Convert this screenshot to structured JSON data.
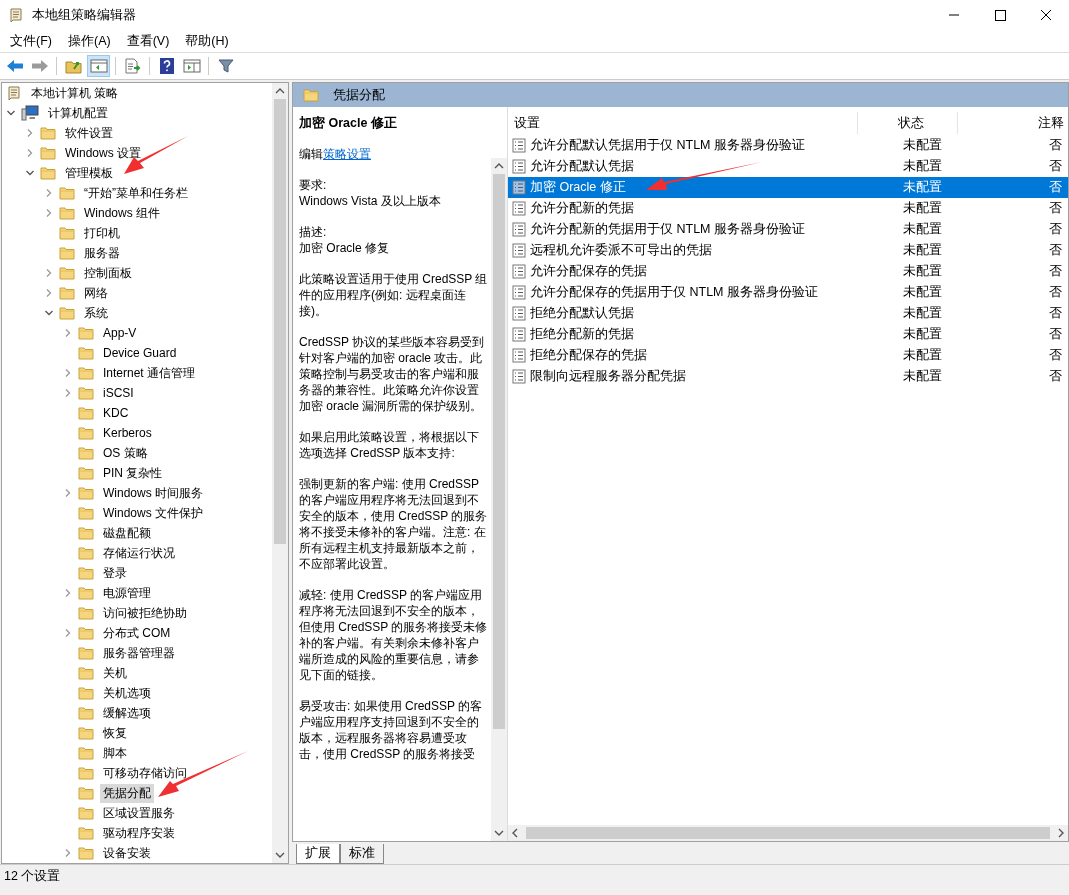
{
  "window": {
    "title": "本地组策略编辑器"
  },
  "menu": [
    "文件(F)",
    "操作(A)",
    "查看(V)",
    "帮助(H)"
  ],
  "toolbar": [
    {
      "kind": "back",
      "disabled": false
    },
    {
      "kind": "forward",
      "disabled": true
    },
    {
      "kind": "separator"
    },
    {
      "kind": "up"
    },
    {
      "kind": "tree",
      "pressed": true
    },
    {
      "kind": "separator"
    },
    {
      "kind": "export"
    },
    {
      "kind": "separator"
    },
    {
      "kind": "help"
    },
    {
      "kind": "pane",
      "pressed": false
    },
    {
      "kind": "separator"
    },
    {
      "kind": "filter"
    }
  ],
  "tree": [
    {
      "label": "本地计算机 策略",
      "kind": "root",
      "selected": false,
      "children": [
        {
          "label": "计算机配置",
          "kind": "computer",
          "expanded": true,
          "selected": false,
          "children": [
            {
              "label": "软件设置",
              "kind": "folder",
              "expanded": false,
              "selected": false
            },
            {
              "label": "Windows 设置",
              "kind": "folder",
              "expanded": false,
              "selected": false
            },
            {
              "label": "管理模板",
              "kind": "folder",
              "expanded": true,
              "selected": false,
              "children": [
                {
                  "label": "“开始”菜单和任务栏",
                  "kind": "folder",
                  "expanded": false,
                  "selected": false
                },
                {
                  "label": "Windows 组件",
                  "kind": "folder",
                  "expanded": false,
                  "selected": false
                },
                {
                  "label": "打印机",
                  "kind": "folder",
                  "selected": false
                },
                {
                  "label": "服务器",
                  "kind": "folder",
                  "selected": false
                },
                {
                  "label": "控制面板",
                  "kind": "folder",
                  "expanded": false,
                  "selected": false
                },
                {
                  "label": "网络",
                  "kind": "folder",
                  "expanded": false,
                  "selected": false
                },
                {
                  "label": "系统",
                  "kind": "folder",
                  "expanded": true,
                  "selected": false,
                  "children": [
                    {
                      "label": "App-V",
                      "kind": "folder",
                      "expanded": false,
                      "selected": false
                    },
                    {
                      "label": "Device Guard",
                      "kind": "folder",
                      "selected": false
                    },
                    {
                      "label": "Internet 通信管理",
                      "kind": "folder",
                      "expanded": false,
                      "selected": false
                    },
                    {
                      "label": "iSCSI",
                      "kind": "folder",
                      "expanded": false,
                      "selected": false
                    },
                    {
                      "label": "KDC",
                      "kind": "folder",
                      "selected": false
                    },
                    {
                      "label": "Kerberos",
                      "kind": "folder",
                      "selected": false
                    },
                    {
                      "label": "OS 策略",
                      "kind": "folder",
                      "selected": false
                    },
                    {
                      "label": "PIN 复杂性",
                      "kind": "folder",
                      "selected": false
                    },
                    {
                      "label": "Windows 时间服务",
                      "kind": "folder",
                      "expanded": false,
                      "selected": false
                    },
                    {
                      "label": "Windows 文件保护",
                      "kind": "folder",
                      "selected": false
                    },
                    {
                      "label": "磁盘配额",
                      "kind": "folder",
                      "selected": false
                    },
                    {
                      "label": "存储运行状况",
                      "kind": "folder",
                      "selected": false
                    },
                    {
                      "label": "登录",
                      "kind": "folder",
                      "selected": false
                    },
                    {
                      "label": "电源管理",
                      "kind": "folder",
                      "expanded": false,
                      "selected": false
                    },
                    {
                      "label": "访问被拒绝协助",
                      "kind": "folder",
                      "selected": false
                    },
                    {
                      "label": "分布式 COM",
                      "kind": "folder",
                      "expanded": false,
                      "selected": false
                    },
                    {
                      "label": "服务器管理器",
                      "kind": "folder",
                      "selected": false
                    },
                    {
                      "label": "关机",
                      "kind": "folder",
                      "selected": false
                    },
                    {
                      "label": "关机选项",
                      "kind": "folder",
                      "selected": false
                    },
                    {
                      "label": "缓解选项",
                      "kind": "folder",
                      "selected": false
                    },
                    {
                      "label": "恢复",
                      "kind": "folder",
                      "selected": false
                    },
                    {
                      "label": "脚本",
                      "kind": "folder",
                      "selected": false
                    },
                    {
                      "label": "可移动存储访问",
                      "kind": "folder",
                      "selected": false
                    },
                    {
                      "label": "凭据分配",
                      "kind": "folder",
                      "selected": true
                    },
                    {
                      "label": "区域设置服务",
                      "kind": "folder",
                      "selected": false
                    },
                    {
                      "label": "驱动程序安装",
                      "kind": "folder",
                      "selected": false
                    },
                    {
                      "label": "设备安装",
                      "kind": "folder",
                      "expanded": false,
                      "selected": false
                    }
                  ]
                }
              ]
            }
          ]
        }
      ]
    }
  ],
  "header": {
    "title": "凭据分配"
  },
  "description": {
    "title": "加密 Oracle 修正",
    "edit_prefix": "编辑",
    "edit_link": "策略设置",
    "paragraphs": [
      "要求:\nWindows Vista 及以上版本",
      "描述:\n加密 Oracle 修复",
      "此策略设置适用于使用 CredSSP 组件的应用程序(例如: 远程桌面连接)。",
      "CredSSP 协议的某些版本容易受到针对客户端的加密 oracle 攻击。此策略控制与易受攻击的客户端和服务器的兼容性。此策略允许你设置加密 oracle 漏洞所需的保护级别。",
      "如果启用此策略设置，将根据以下选项选择 CredSSP 版本支持:",
      "强制更新的客户端: 使用 CredSSP 的客户端应用程序将无法回退到不安全的版本，使用 CredSSP 的服务将不接受未修补的客户端。注意: 在所有远程主机支持最新版本之前，不应部署此设置。",
      "减轻: 使用 CredSSP 的客户端应用程序将无法回退到不安全的版本，但使用 CredSSP 的服务将接受未修补的客户端。有关剩余未修补客户端所造成的风险的重要信息，请参见下面的链接。",
      "易受攻击: 如果使用 CredSSP 的客户端应用程序支持回退到不安全的版本，远程服务器将容易遭受攻击，使用 CredSSP 的服务将接受"
    ]
  },
  "table": {
    "columns": [
      "设置",
      "状态",
      "注释"
    ],
    "rows": [
      {
        "name": "允许分配默认凭据用于仅 NTLM 服务器身份验证",
        "state": "未配置",
        "comment": "否",
        "selected": false
      },
      {
        "name": "允许分配默认凭据",
        "state": "未配置",
        "comment": "否",
        "selected": false
      },
      {
        "name": "加密 Oracle 修正",
        "state": "未配置",
        "comment": "否",
        "selected": true
      },
      {
        "name": "允许分配新的凭据",
        "state": "未配置",
        "comment": "否",
        "selected": false
      },
      {
        "name": "允许分配新的凭据用于仅 NTLM 服务器身份验证",
        "state": "未配置",
        "comment": "否",
        "selected": false
      },
      {
        "name": "远程机允许委派不可导出的凭据",
        "state": "未配置",
        "comment": "否",
        "selected": false
      },
      {
        "name": "允许分配保存的凭据",
        "state": "未配置",
        "comment": "否",
        "selected": false
      },
      {
        "name": "允许分配保存的凭据用于仅 NTLM 服务器身份验证",
        "state": "未配置",
        "comment": "否",
        "selected": false
      },
      {
        "name": "拒绝分配默认凭据",
        "state": "未配置",
        "comment": "否",
        "selected": false
      },
      {
        "name": "拒绝分配新的凭据",
        "state": "未配置",
        "comment": "否",
        "selected": false
      },
      {
        "name": "拒绝分配保存的凭据",
        "state": "未配置",
        "comment": "否",
        "selected": false
      },
      {
        "name": "限制向远程服务器分配凭据",
        "state": "未配置",
        "comment": "否",
        "selected": false
      }
    ]
  },
  "view_tabs": [
    {
      "label": "扩展",
      "selected": true
    },
    {
      "label": "标准",
      "selected": false
    }
  ],
  "status_bar": "12 个设置"
}
